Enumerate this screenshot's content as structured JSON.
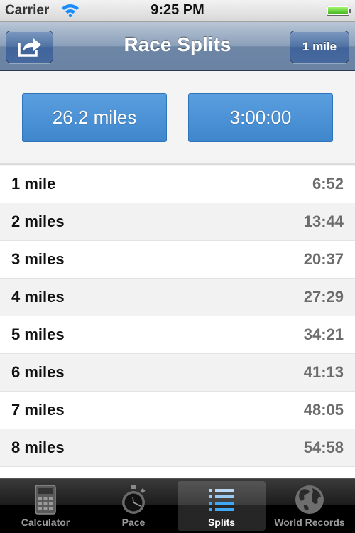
{
  "status_bar": {
    "carrier": "Carrier",
    "time": "9:25 PM",
    "battery_level": 1.0
  },
  "nav_bar": {
    "title": "Race Splits",
    "share_icon": "share-arrow-icon",
    "unit_button_label": "1 mile"
  },
  "inputs": {
    "distance": "26.2 miles",
    "time": "3:00:00"
  },
  "splits": [
    {
      "label": "1 mile",
      "time": "6:52"
    },
    {
      "label": "2 miles",
      "time": "13:44"
    },
    {
      "label": "3 miles",
      "time": "20:37"
    },
    {
      "label": "4 miles",
      "time": "27:29"
    },
    {
      "label": "5 miles",
      "time": "34:21"
    },
    {
      "label": "6 miles",
      "time": "41:13"
    },
    {
      "label": "7 miles",
      "time": "48:05"
    },
    {
      "label": "8 miles",
      "time": "54:58"
    }
  ],
  "tab_bar": {
    "tabs": [
      {
        "label": "Calculator",
        "icon": "calculator-icon",
        "active": false
      },
      {
        "label": "Pace",
        "icon": "stopwatch-icon",
        "active": false
      },
      {
        "label": "Splits",
        "icon": "list-icon",
        "active": true
      },
      {
        "label": "World Records",
        "icon": "globe-icon",
        "active": false
      }
    ]
  },
  "colors": {
    "nav_bar": "#7a92b2",
    "input_button": "#4a91d6",
    "active_tab_icon": "#3fa9f5"
  }
}
